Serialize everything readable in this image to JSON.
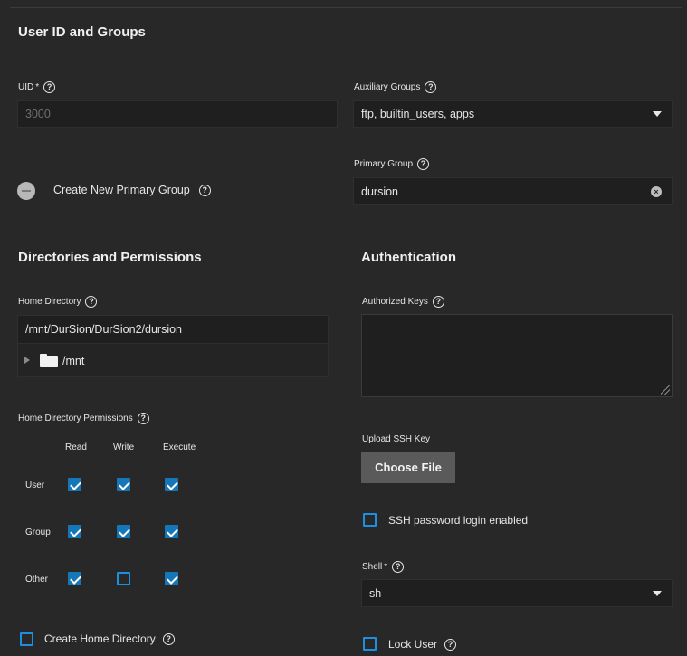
{
  "user_id_groups": {
    "title": "User ID and Groups",
    "uid_label": "UID",
    "uid_required": "*",
    "uid_value": "3000",
    "aux_groups_label": "Auxiliary Groups",
    "aux_groups_value": "ftp, builtin_users, apps",
    "create_primary_group_label": "Create New Primary Group",
    "primary_group_label": "Primary Group",
    "primary_group_value": "dursion"
  },
  "directories": {
    "title": "Directories and Permissions",
    "home_dir_label": "Home Directory",
    "home_dir_value": "/mnt/DurSion/DurSion2/dursion",
    "tree_root": "/mnt",
    "permissions_label": "Home Directory Permissions",
    "columns": [
      "Read",
      "Write",
      "Execute"
    ],
    "rows": [
      {
        "name": "User",
        "read": true,
        "write": true,
        "execute": true
      },
      {
        "name": "Group",
        "read": true,
        "write": true,
        "execute": true
      },
      {
        "name": "Other",
        "read": true,
        "write": false,
        "execute": true
      }
    ],
    "create_home_label": "Create Home Directory"
  },
  "authentication": {
    "title": "Authentication",
    "authorized_keys_label": "Authorized Keys",
    "upload_ssh_label": "Upload SSH Key",
    "choose_file_label": "Choose File",
    "ssh_password_label": "SSH password login enabled",
    "shell_label": "Shell",
    "shell_required": "*",
    "shell_value": "sh",
    "lock_user_label": "Lock User"
  },
  "icons": {
    "help": "?",
    "clear": "×"
  },
  "colors": {
    "accent": "#1577b8",
    "background": "#282828",
    "input_bg": "#1f1f1f"
  }
}
